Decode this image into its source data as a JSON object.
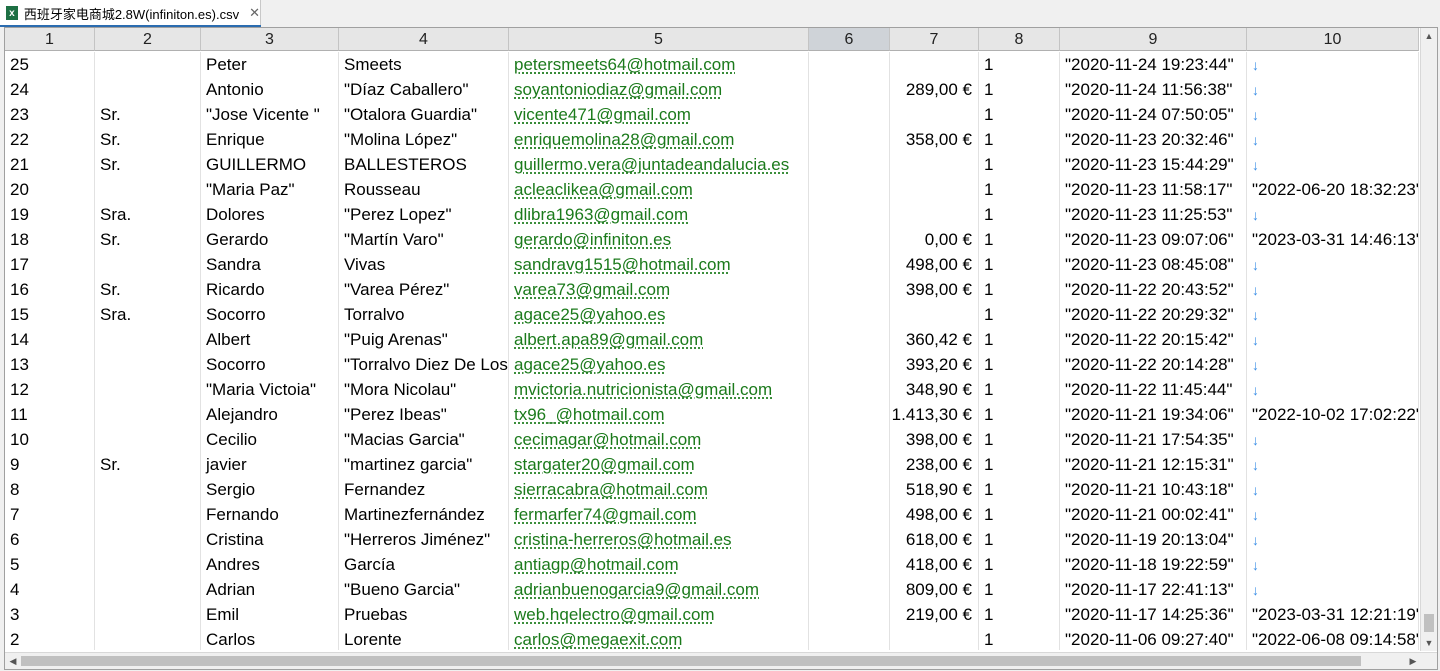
{
  "tab": {
    "title": "西班牙家电商城2.8W(infiniton.es).csv",
    "close": "✕",
    "icon": "x"
  },
  "columns": [
    "1",
    "2",
    "3",
    "4",
    "5",
    "6",
    "7",
    "8",
    "9",
    "10"
  ],
  "selected_column": "6",
  "scrollbar": {
    "up": "▲",
    "down": "▼",
    "left": "◀",
    "right": "▶"
  },
  "rows": [
    {
      "c1": "25",
      "c2": "",
      "c3": "Peter",
      "c4": "Smeets",
      "c5": "petersmeets64@hotmail.com",
      "c6": "",
      "c7": "",
      "c8": "1",
      "c9": "\"2020-11-24 19:23:44\"",
      "c10": "↓"
    },
    {
      "c1": "24",
      "c2": "",
      "c3": "Antonio",
      "c4": "\"Díaz Caballero\"",
      "c5": "soyantoniodiaz@gmail.com",
      "c6": "",
      "c7": "289,00 €",
      "c8": "1",
      "c9": "\"2020-11-24 11:56:38\"",
      "c10": "↓"
    },
    {
      "c1": "23",
      "c2": "Sr.",
      "c3": "\"Jose Vicente \"",
      "c4": "\"Otalora Guardia\"",
      "c5": "vicente471@gmail.com",
      "c6": "",
      "c7": "",
      "c8": "1",
      "c9": "\"2020-11-24 07:50:05\"",
      "c10": "↓"
    },
    {
      "c1": "22",
      "c2": "Sr.",
      "c3": "Enrique",
      "c4": "\"Molina López\"",
      "c5": "enriquemolina28@gmail.com",
      "c6": "",
      "c7": "358,00 €",
      "c8": "1",
      "c9": "\"2020-11-23 20:32:46\"",
      "c10": "↓"
    },
    {
      "c1": "21",
      "c2": "Sr.",
      "c3": "GUILLERMO",
      "c4": "BALLESTEROS",
      "c5": "guillermo.vera@juntadeandalucia.es",
      "c6": "",
      "c7": "",
      "c8": "1",
      "c9": "\"2020-11-23 15:44:29\"",
      "c10": "↓"
    },
    {
      "c1": "20",
      "c2": "",
      "c3": "\"Maria Paz\"",
      "c4": "Rousseau",
      "c5": "acleaclikea@gmail.com",
      "c6": "",
      "c7": "",
      "c8": "1",
      "c9": "\"2020-11-23 11:58:17\"",
      "c10": "\"2022-06-20 18:32:23\""
    },
    {
      "c1": "19",
      "c2": "Sra.",
      "c3": "Dolores",
      "c4": "\"Perez Lopez\"",
      "c5": "dlibra1963@gmail.com",
      "c6": "",
      "c7": "",
      "c8": "1",
      "c9": "\"2020-11-23 11:25:53\"",
      "c10": "↓"
    },
    {
      "c1": "18",
      "c2": "Sr.",
      "c3": "Gerardo",
      "c4": "\"Martín Varo\"",
      "c5": "gerardo@infiniton.es",
      "c6": "",
      "c7": "0,00 €",
      "c8": "1",
      "c9": "\"2020-11-23 09:07:06\"",
      "c10": "\"2023-03-31 14:46:13\""
    },
    {
      "c1": "17",
      "c2": "",
      "c3": "Sandra",
      "c4": "Vivas",
      "c5": "sandravg1515@hotmail.com",
      "c6": "",
      "c7": "498,00 €",
      "c8": "1",
      "c9": "\"2020-11-23 08:45:08\"",
      "c10": "↓"
    },
    {
      "c1": "16",
      "c2": "Sr.",
      "c3": "Ricardo",
      "c4": "\"Varea Pérez\"",
      "c5": "varea73@gmail.com",
      "c6": "",
      "c7": "398,00 €",
      "c8": "1",
      "c9": "\"2020-11-22 20:43:52\"",
      "c10": "↓"
    },
    {
      "c1": "15",
      "c2": "Sra.",
      "c3": "Socorro",
      "c4": "Torralvo",
      "c5": "agace25@yahoo.es",
      "c6": "",
      "c7": "",
      "c8": "1",
      "c9": "\"2020-11-22 20:29:32\"",
      "c10": "↓"
    },
    {
      "c1": "14",
      "c2": "",
      "c3": "Albert",
      "c4": "\"Puig Arenas\"",
      "c5": "albert.apa89@gmail.com",
      "c6": "",
      "c7": "360,42 €",
      "c8": "1",
      "c9": "\"2020-11-22 20:15:42\"",
      "c10": "↓"
    },
    {
      "c1": "13",
      "c2": "",
      "c3": "Socorro",
      "c4": "\"Torralvo Diez De Los",
      "c5": "agace25@yahoo.es",
      "c6": "",
      "c7": "393,20 €",
      "c8": "1",
      "c9": "\"2020-11-22 20:14:28\"",
      "c10": "↓"
    },
    {
      "c1": "12",
      "c2": "",
      "c3": "\"Maria Victoia\"",
      "c4": "\"Mora Nicolau\"",
      "c5": "mvictoria.nutricionista@gmail.com",
      "c6": "",
      "c7": "348,90 €",
      "c8": "1",
      "c9": "\"2020-11-22 11:45:44\"",
      "c10": "↓"
    },
    {
      "c1": "11",
      "c2": "",
      "c3": "Alejandro",
      "c4": "\"Perez Ibeas\"",
      "c5": "tx96_@hotmail.com",
      "c6": "",
      "c7": "1.413,30 €",
      "c8": "1",
      "c9": "\"2020-11-21 19:34:06\"",
      "c10": "\"2022-10-02 17:02:22\""
    },
    {
      "c1": "10",
      "c2": "",
      "c3": "Cecilio",
      "c4": "\"Macias Garcia\"",
      "c5": "cecimagar@hotmail.com",
      "c6": "",
      "c7": "398,00 €",
      "c8": "1",
      "c9": "\"2020-11-21 17:54:35\"",
      "c10": "↓"
    },
    {
      "c1": "9",
      "c2": "Sr.",
      "c3": "javier",
      "c4": "\"martinez garcia\"",
      "c5": "stargater20@gmail.com",
      "c6": "",
      "c7": "238,00 €",
      "c8": "1",
      "c9": "\"2020-11-21 12:15:31\"",
      "c10": "↓"
    },
    {
      "c1": "8",
      "c2": "",
      "c3": "Sergio",
      "c4": "Fernandez",
      "c5": "sierracabra@hotmail.com",
      "c6": "",
      "c7": "518,90 €",
      "c8": "1",
      "c9": "\"2020-11-21 10:43:18\"",
      "c10": "↓"
    },
    {
      "c1": "7",
      "c2": "",
      "c3": "Fernando",
      "c4": "Martinezfernández",
      "c5": "fermarfer74@gmail.com",
      "c6": "",
      "c7": "498,00 €",
      "c8": "1",
      "c9": "\"2020-11-21 00:02:41\"",
      "c10": "↓"
    },
    {
      "c1": "6",
      "c2": "",
      "c3": "Cristina",
      "c4": "\"Herreros Jiménez\"",
      "c5": "cristina-herreros@hotmail.es",
      "c6": "",
      "c7": "618,00 €",
      "c8": "1",
      "c9": "\"2020-11-19 20:13:04\"",
      "c10": "↓"
    },
    {
      "c1": "5",
      "c2": "",
      "c3": "Andres",
      "c4": "García",
      "c5": "antiagp@hotmail.com",
      "c6": "",
      "c7": "418,00 €",
      "c8": "1",
      "c9": "\"2020-11-18 19:22:59\"",
      "c10": "↓"
    },
    {
      "c1": "4",
      "c2": "",
      "c3": "Adrian",
      "c4": "\"Bueno Garcia\"",
      "c5": "adrianbuenogarcia9@gmail.com",
      "c6": "",
      "c7": "809,00 €",
      "c8": "1",
      "c9": "\"2020-11-17 22:41:13\"",
      "c10": "↓"
    },
    {
      "c1": "3",
      "c2": "",
      "c3": "Emil",
      "c4": "Pruebas",
      "c5": "web.hqelectro@gmail.com",
      "c6": "",
      "c7": "219,00 €",
      "c8": "1",
      "c9": "\"2020-11-17 14:25:36\"",
      "c10": "\"2023-03-31 12:21:19\""
    },
    {
      "c1": "2",
      "c2": "",
      "c3": "Carlos",
      "c4": "Lorente",
      "c5": "carlos@megaexit.com",
      "c6": "",
      "c7": "",
      "c8": "1",
      "c9": "\"2020-11-06 09:27:40\"",
      "c10": "\"2022-06-08 09:14:58\""
    }
  ]
}
